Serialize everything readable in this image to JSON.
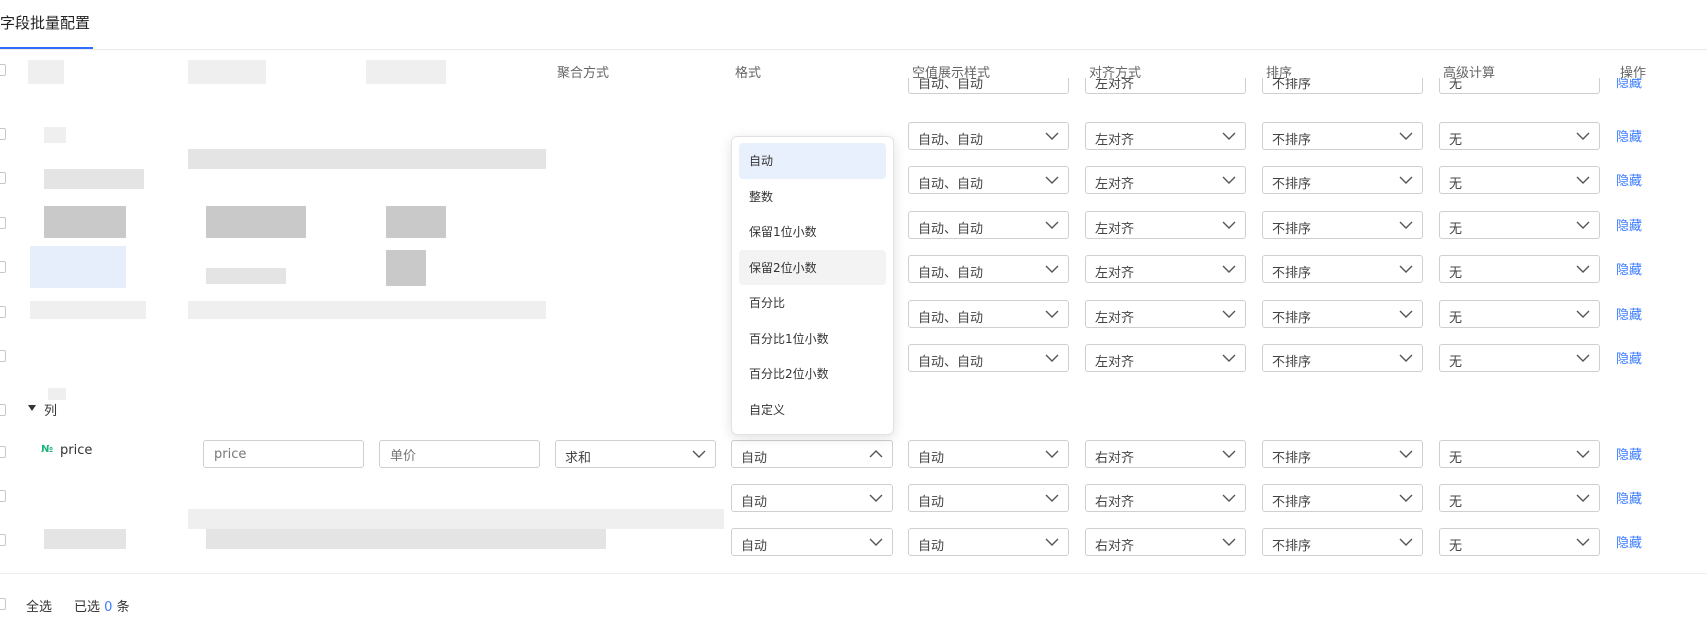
{
  "tab": {
    "title": "字段批量配置"
  },
  "columns": {
    "aggregation": "聚合方式",
    "format": "格式",
    "null_display": "空值展示样式",
    "alignment": "对齐方式",
    "sort": "排序",
    "advanced": "高级计算",
    "action": "操作"
  },
  "rows": [
    {
      "format": "",
      "null_display": "自动、自动",
      "alignment": "左对齐",
      "sort": "不排序",
      "advanced": "无",
      "action": "隐藏"
    },
    {
      "format": "",
      "null_display": "自动、自动",
      "alignment": "左对齐",
      "sort": "不排序",
      "advanced": "无",
      "action": "隐藏"
    },
    {
      "format": "",
      "null_display": "自动、自动",
      "alignment": "左对齐",
      "sort": "不排序",
      "advanced": "无",
      "action": "隐藏"
    },
    {
      "format": "",
      "null_display": "自动、自动",
      "alignment": "左对齐",
      "sort": "不排序",
      "advanced": "无",
      "action": "隐藏"
    },
    {
      "format": "",
      "null_display": "自动、自动",
      "alignment": "左对齐",
      "sort": "不排序",
      "advanced": "无",
      "action": "隐藏"
    },
    {
      "format": "",
      "null_display": "自动、自动",
      "alignment": "左对齐",
      "sort": "不排序",
      "advanced": "无",
      "action": "隐藏"
    }
  ],
  "group": {
    "label": "列"
  },
  "price_row": {
    "icon": "№",
    "name": "price",
    "field_value": "price",
    "alias_value": "单价",
    "aggregation": "求和",
    "format": "自动",
    "null_display": "自动",
    "alignment": "右对齐",
    "sort": "不排序",
    "advanced": "无",
    "action": "隐藏"
  },
  "extra_rows": [
    {
      "format": "自动",
      "null_display": "自动",
      "alignment": "右对齐",
      "sort": "不排序",
      "advanced": "无",
      "action": "隐藏"
    },
    {
      "format": "自动",
      "null_display": "自动",
      "alignment": "右对齐",
      "sort": "不排序",
      "advanced": "无",
      "action": "隐藏"
    }
  ],
  "format_dropdown": {
    "options": [
      "自动",
      "整数",
      "保留1位小数",
      "保留2位小数",
      "百分比",
      "百分比1位小数",
      "百分比2位小数",
      "自定义"
    ],
    "selected": "自动",
    "hovered": "保留2位小数"
  },
  "footer": {
    "select_all": "全选",
    "selected_prefix": "已选",
    "selected_count": "0",
    "selected_suffix": "条"
  },
  "colors": {
    "accent": "#3b7cff",
    "field_icon": "#1fb37a"
  }
}
